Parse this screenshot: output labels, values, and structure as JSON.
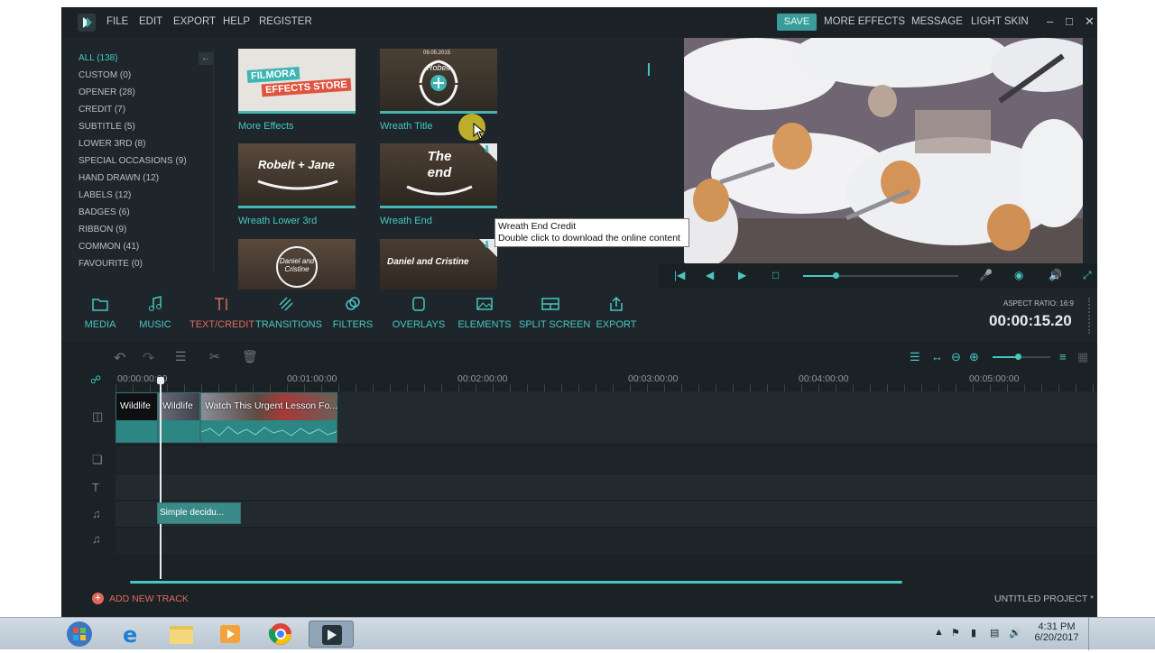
{
  "menubar": {
    "items": [
      "FILE",
      "EDIT",
      "EXPORT",
      "HELP",
      "REGISTER"
    ],
    "save": "SAVE",
    "more_effects": "MORE EFFECTS",
    "message": "MESSAGE",
    "light_skin": "LIGHT SKIN"
  },
  "categories": [
    "ALL (138)",
    "CUSTOM (0)",
    "OPENER (28)",
    "CREDIT (7)",
    "SUBTITLE (5)",
    "LOWER 3RD (8)",
    "SPECIAL OCCASIONS (9)",
    "HAND DRAWN (12)",
    "LABELS (12)",
    "BADGES (6)",
    "RIBBON (9)",
    "COMMON (41)",
    "FAVOURITE (0)"
  ],
  "thumbnails": {
    "store": {
      "line1": "FILMORA",
      "line2": "EFFECTS STORE",
      "label": "More Effects"
    },
    "wreath_title": {
      "overlay": "Robelt",
      "date": "09.05.2015",
      "label": "Wreath Title"
    },
    "wreath_lower": {
      "overlay": "Robelt + Jane",
      "label": "Wreath Lower 3rd"
    },
    "wreath_end": {
      "overlay": "The end",
      "label": "Wreath End"
    },
    "daniel1": {
      "overlay": "Daniel and Cristine"
    },
    "daniel2": {
      "overlay": "Daniel and Cristine"
    }
  },
  "tooltip": {
    "title": "Wreath End Credit",
    "body": "Double click to download the online content"
  },
  "toolbar": [
    {
      "label": "MEDIA",
      "icon": "folder-icon"
    },
    {
      "label": "MUSIC",
      "icon": "music-note-icon"
    },
    {
      "label": "TEXT/CREDIT",
      "icon": "text-icon"
    },
    {
      "label": "TRANSITIONS",
      "icon": "transitions-icon"
    },
    {
      "label": "FILTERS",
      "icon": "filters-icon"
    },
    {
      "label": "OVERLAYS",
      "icon": "overlays-icon"
    },
    {
      "label": "ELEMENTS",
      "icon": "elements-icon"
    },
    {
      "label": "SPLIT SCREEN",
      "icon": "split-screen-icon"
    },
    {
      "label": "EXPORT",
      "icon": "export-icon"
    }
  ],
  "aspect_ratio": "ASPECT RATIO: 16:9",
  "timecode": "00:00:15.20",
  "ruler": [
    "00:00:00:00",
    "00:01:00:00",
    "00:02:00:00",
    "00:03:00:00",
    "00:04:00:00",
    "00:05:00:00"
  ],
  "clips": {
    "video": [
      "Wildlife",
      "Wildlife",
      "Watch This Urgent Lesson Fo..."
    ],
    "audio": [
      "Simple decidu..."
    ]
  },
  "add_track": "ADD NEW TRACK",
  "project": "UNTITLED PROJECT *",
  "tray": {
    "time": "4:31 PM",
    "date": "6/20/2017"
  },
  "colors": {
    "accent": "#47c6c2",
    "active": "#e06a5c",
    "background": "#1f262b"
  }
}
